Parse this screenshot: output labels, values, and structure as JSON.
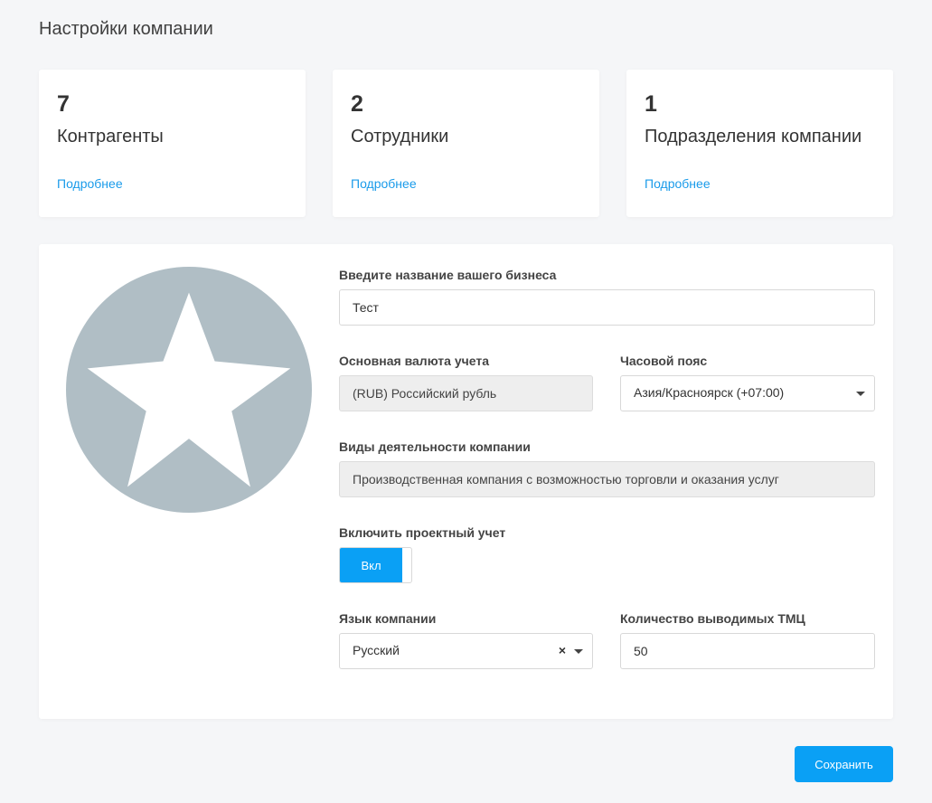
{
  "page": {
    "title": "Настройки компании"
  },
  "cards": [
    {
      "count": "7",
      "label": "Контрагенты",
      "more": "Подробнее"
    },
    {
      "count": "2",
      "label": "Сотрудники",
      "more": "Подробнее"
    },
    {
      "count": "1",
      "label": "Подразделения компании",
      "more": "Подробнее"
    }
  ],
  "form": {
    "business_name": {
      "label": "Введите название вашего бизнеса",
      "value": "Тест"
    },
    "currency": {
      "label": "Основная валюта учета",
      "value": "(RUB) Российский рубль"
    },
    "timezone": {
      "label": "Часовой пояс",
      "value": "Азия/Красноярск (+07:00)"
    },
    "activity": {
      "label": "Виды деятельности компании",
      "value": "Производственная компания с возможностью торговли и оказания услуг"
    },
    "project_accounting": {
      "label": "Включить проектный учет",
      "toggle_text": "Вкл"
    },
    "language": {
      "label": "Язык компании",
      "value": "Русский",
      "clear": "×"
    },
    "items_count": {
      "label": "Количество выводимых ТМЦ",
      "value": "50"
    }
  },
  "actions": {
    "save_label": "Сохранить"
  },
  "icons": {
    "avatar": "star-icon",
    "dropdown": "chevron-down-icon",
    "clear": "close-icon"
  },
  "colors": {
    "accent": "#0aa0f5",
    "link": "#1a9bea",
    "avatar_bg": "#b0bec5"
  }
}
